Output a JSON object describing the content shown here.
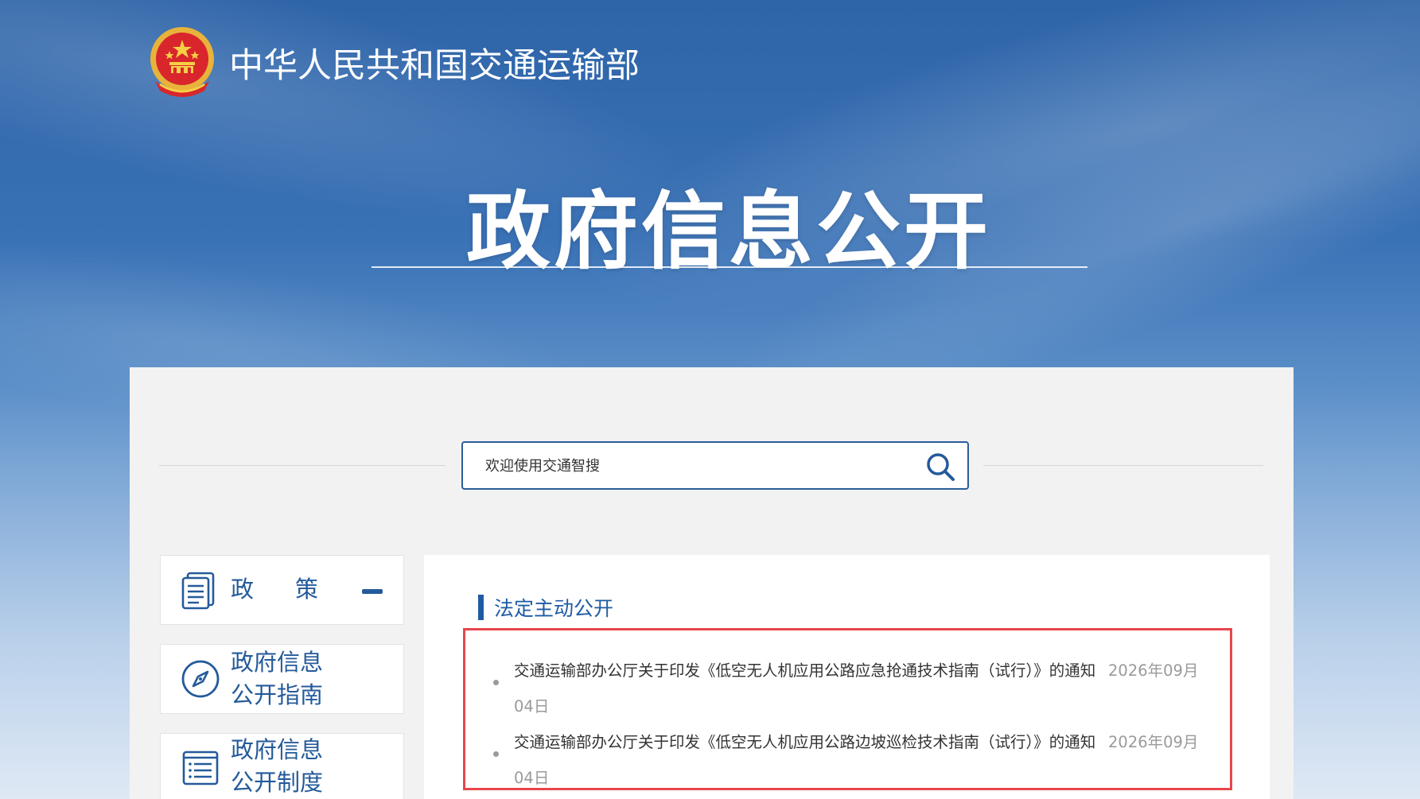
{
  "header": {
    "ministry_name": "中华人民共和国交通运输部",
    "main_title": "政府信息公开"
  },
  "search": {
    "placeholder": "欢迎使用交通智搜"
  },
  "sidebar": {
    "items": [
      {
        "label_parts": [
          "政",
          "策"
        ],
        "icon": "document-icon",
        "expanded": true
      },
      {
        "label_lines": [
          "政府信息",
          "公开指南"
        ],
        "icon": "compass-icon"
      },
      {
        "label_lines": [
          "政府信息",
          "公开制度"
        ],
        "icon": "list-icon"
      }
    ]
  },
  "main": {
    "section_title": "法定主动公开",
    "news": [
      {
        "title": "交通运输部办公厅关于印发《低空无人机应用公路应急抢通技术指南（试行）》的通知",
        "date_part1": "2026年09月",
        "date_part2": "04日"
      },
      {
        "title": "交通运输部办公厅关于印发《低空无人机应用公路边坡巡检技术指南（试行）》的通知",
        "date_part1": "2026年09月",
        "date_part2": "04日"
      }
    ]
  },
  "colors": {
    "brand_blue": "#245a9a",
    "highlight_red": "#e8464a",
    "date_gray": "#9a9a9a"
  }
}
